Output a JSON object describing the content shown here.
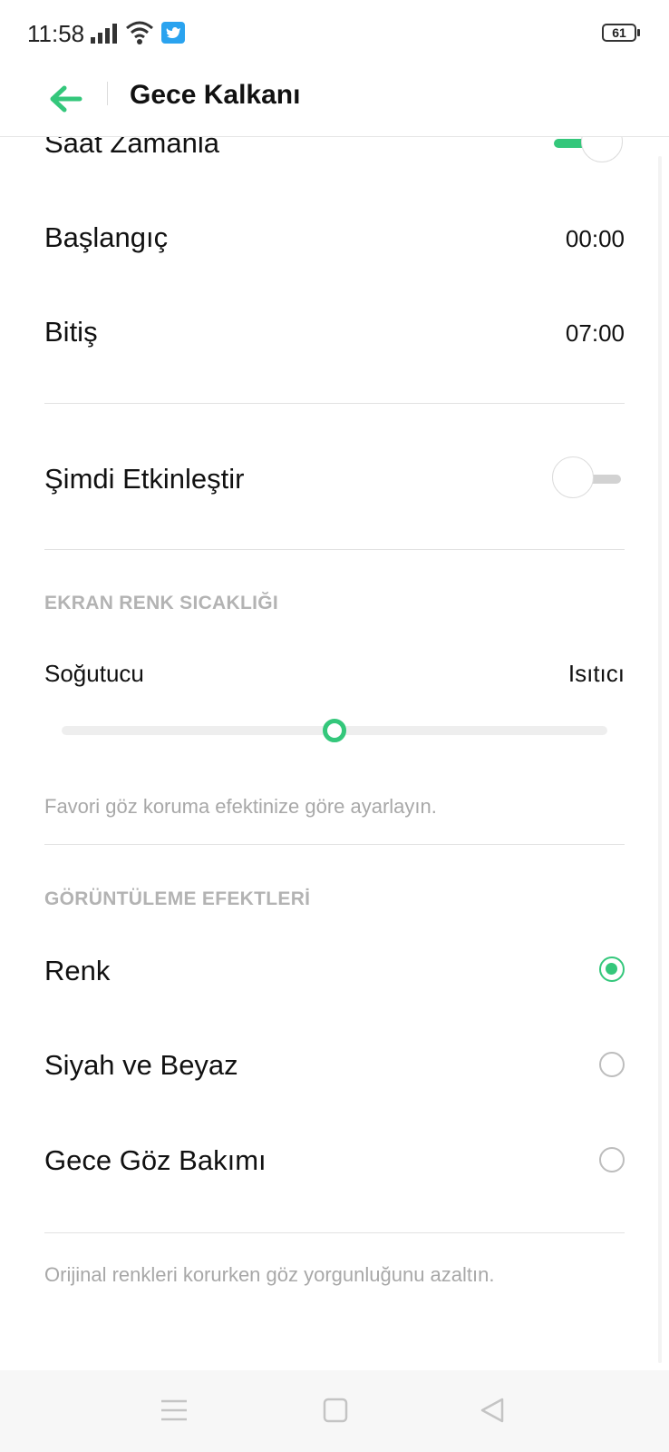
{
  "status_bar": {
    "time": "11:58",
    "battery": "61"
  },
  "header": {
    "title": "Gece Kalkanı"
  },
  "schedule": {
    "label": "Saat Zamanla",
    "enabled": true,
    "start_label": "Başlangıç",
    "start_value": "00:00",
    "end_label": "Bitiş",
    "end_value": "07:00"
  },
  "activate_now": {
    "label": "Şimdi Etkinleştir",
    "enabled": false
  },
  "color_temperature": {
    "section_title": "EKRAN RENK SICAKLIĞI",
    "left_label": "Soğutucu",
    "right_label": "Isıtıcı",
    "level": 0.5,
    "hint": "Favori göz koruma efektinize göre ayarlayın."
  },
  "display_effects": {
    "section_title": "GÖRÜNTÜLEME EFEKTLERİ",
    "options": [
      {
        "label": "Renk",
        "selected": true
      },
      {
        "label": "Siyah ve Beyaz",
        "selected": false
      },
      {
        "label": "Gece Göz Bakımı",
        "selected": false
      }
    ],
    "hint": "Orijinal renkleri korurken göz yorgunluğunu azaltın."
  },
  "colors": {
    "accent": "#34c77b",
    "twitter": "#2aa3ef"
  },
  "icons": {
    "back": "arrow-left-icon",
    "signal": "signal-bars-icon",
    "wifi": "wifi-icon",
    "notification": "twitter-icon",
    "nav_menu": "menu-lines-icon",
    "nav_home": "square-icon",
    "nav_back": "triangle-back-icon"
  }
}
